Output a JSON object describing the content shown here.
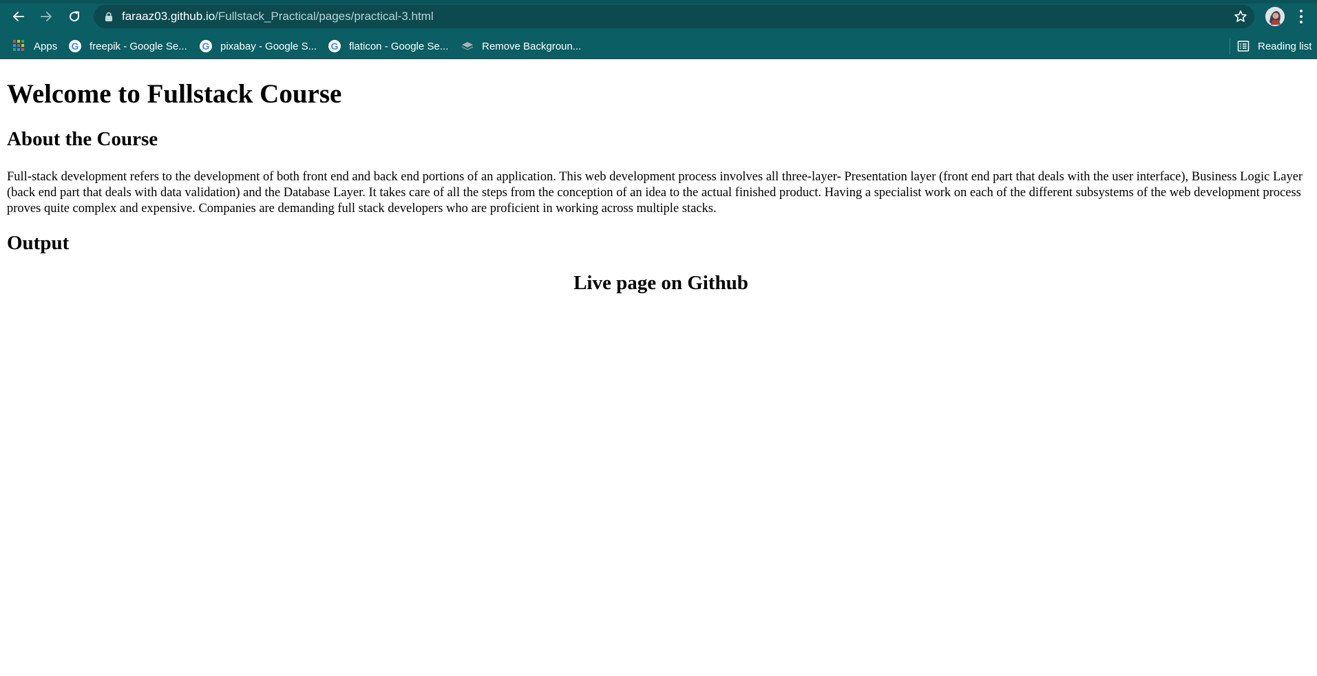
{
  "browser": {
    "address": {
      "domain": "faraaz03.github.io",
      "path": "/Fullstack_Practical/pages/practical-3.html"
    },
    "bookmarks": [
      {
        "label": "Apps",
        "icon": "apps-grid-icon"
      },
      {
        "label": "freepik - Google Se...",
        "icon": "google-icon"
      },
      {
        "label": "pixabay - Google S...",
        "icon": "google-icon"
      },
      {
        "label": "flaticon - Google Se...",
        "icon": "google-icon"
      },
      {
        "label": "Remove Backgroun...",
        "icon": "remove-bg-icon"
      }
    ],
    "reading_list": {
      "label": "Reading list",
      "icon": "reading-list-icon"
    },
    "colors": {
      "toolbar": "#0b5e63",
      "omnibox": "#0d4a50"
    }
  },
  "page": {
    "title": "Welcome to Fullstack Course",
    "about_heading": "About the Course",
    "about_text": "Full-stack development refers to the development of both front end and back end portions of an application. This web development process involves all three-layer- Presentation layer (front end part that deals with the user interface), Business Logic Layer (back end part that deals with data validation) and the Database Layer. It takes care of all the steps from the conception of an idea to the actual finished product. Having a specialist work on each of the different subsystems of the web development process proves quite complex and expensive. Companies are demanding full stack developers who are proficient in working across multiple stacks.",
    "output_heading": "Output",
    "live_link": "Live page on Github"
  }
}
